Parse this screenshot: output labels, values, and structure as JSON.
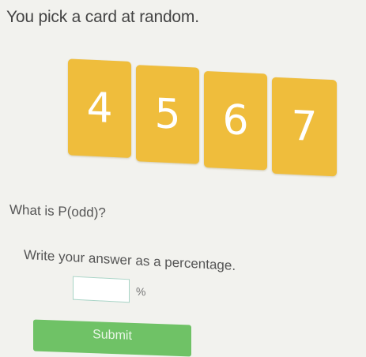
{
  "prompt": "You pick a card at random.",
  "cards": [
    "4",
    "5",
    "6",
    "7"
  ],
  "question": "What is P(odd)?",
  "instruction": "Write your answer as a percentage.",
  "answer": {
    "value": "",
    "unit": "%"
  },
  "submit_label": "Submit",
  "colors": {
    "card": "#efbd3c",
    "card_text": "#ffffff",
    "submit": "#6fc266",
    "input_border": "#a9d4c6",
    "background": "#f2f2ee"
  }
}
